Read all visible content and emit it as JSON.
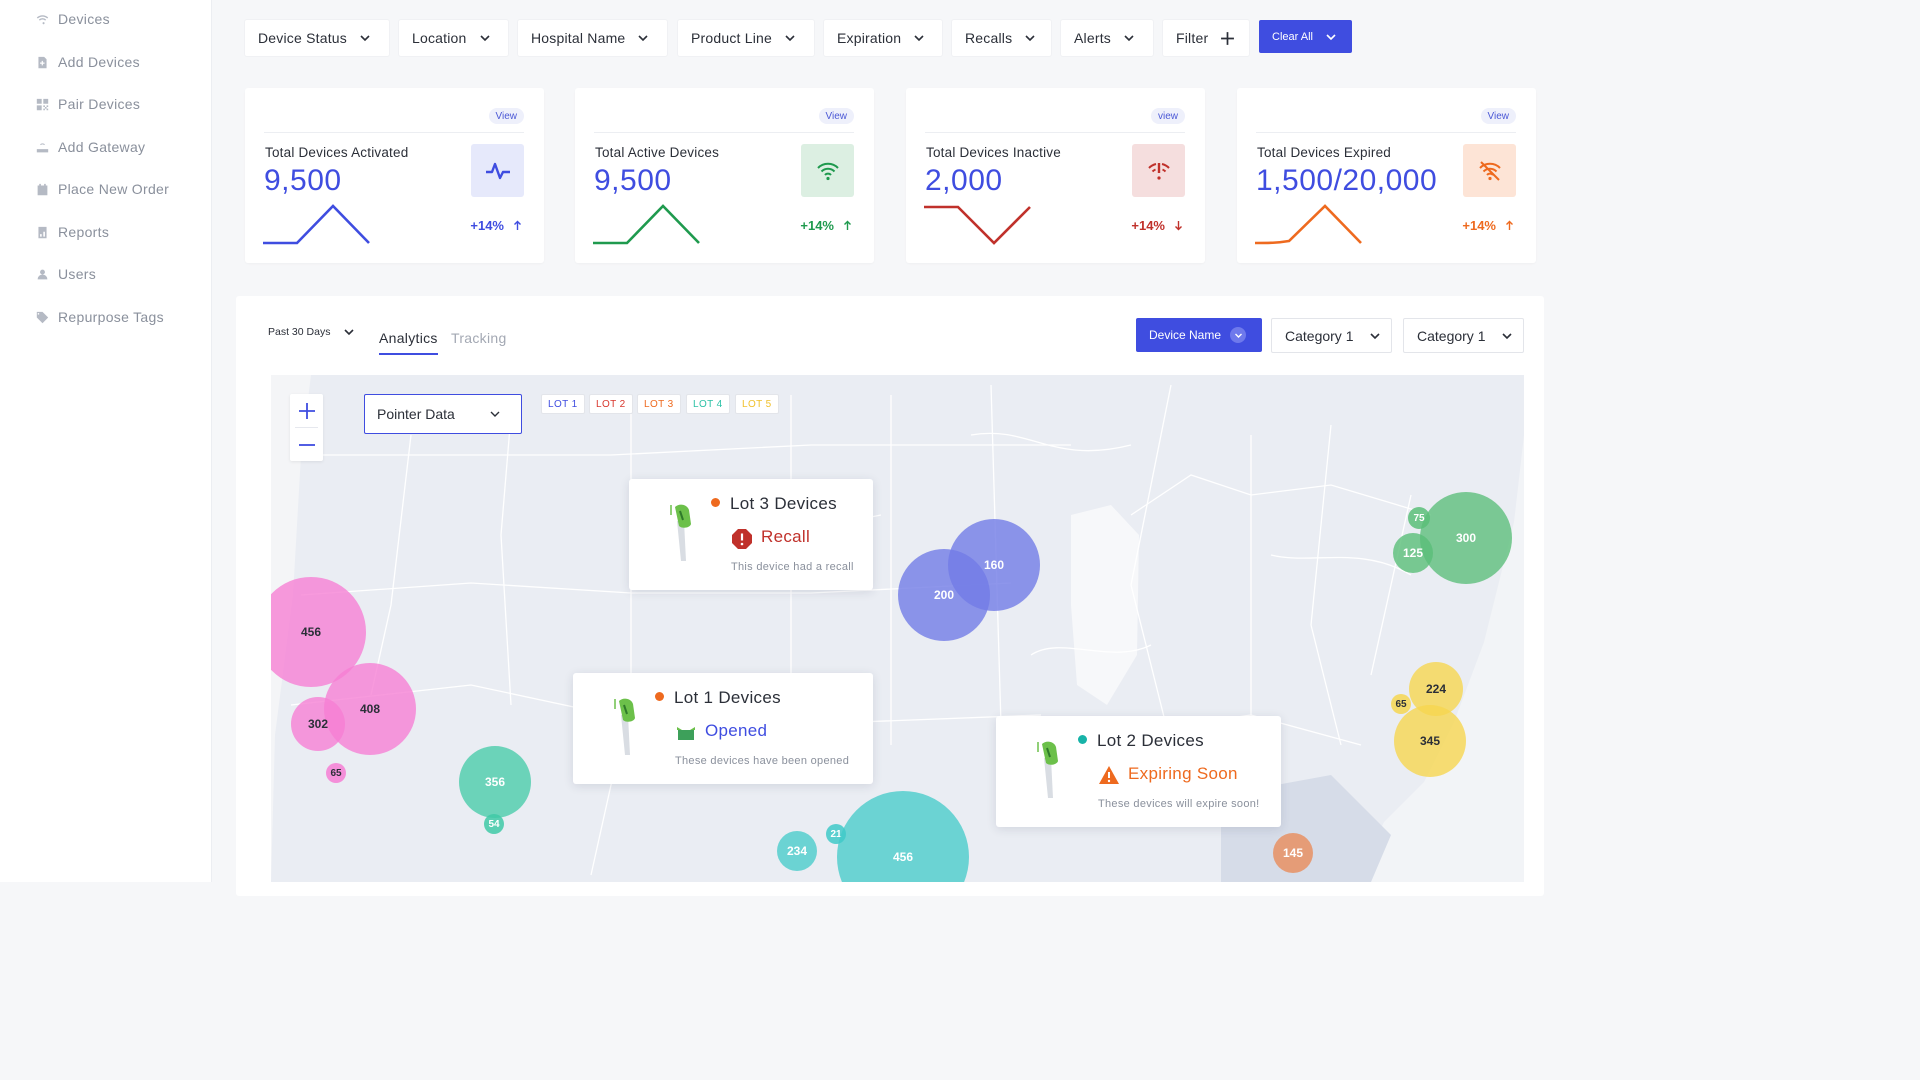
{
  "sidebar": {
    "items": [
      {
        "label": "Devices",
        "icon": "wifi-icon"
      },
      {
        "label": "Add Devices",
        "icon": "file-plus-icon"
      },
      {
        "label": "Pair Devices",
        "icon": "qr-icon"
      },
      {
        "label": "Add Gateway",
        "icon": "router-icon"
      },
      {
        "label": "Place New Order",
        "icon": "calendar-icon"
      },
      {
        "label": "Reports",
        "icon": "report-icon"
      },
      {
        "label": "Users",
        "icon": "users-icon"
      },
      {
        "label": "Repurpose Tags",
        "icon": "tag-icon"
      }
    ]
  },
  "filters": {
    "items": [
      "Device Status",
      "Location",
      "Hospital Name",
      "Product Line",
      "Expiration",
      "Recalls",
      "Alerts"
    ],
    "filter_label": "Filter",
    "clear_label": "Clear All"
  },
  "cards": [
    {
      "view": "View",
      "label": "Total Devices Activated",
      "value": "9,500",
      "pct": "+14%",
      "color": "#3f4de0",
      "bg": "#e6e9fb",
      "direction": "up",
      "icon": "activity-icon"
    },
    {
      "view": "View",
      "label": "Total Active Devices",
      "value": "9,500",
      "pct": "+14%",
      "color": "#1f9a4e",
      "bg": "#dcefe2",
      "direction": "up",
      "icon": "wifi-icon"
    },
    {
      "view": "view",
      "label": "Total Devices Inactive",
      "value": "2,000",
      "pct": "+14%",
      "color": "#c0312b",
      "bg": "#f5dede",
      "direction": "down",
      "icon": "wifi-alert-icon"
    },
    {
      "view": "View",
      "label": "Total Devices Expired",
      "value": "1,500/20,000",
      "pct": "+14%",
      "color": "#ee6a1f",
      "bg": "#fde4d6",
      "direction": "up",
      "icon": "wifi-off-icon"
    }
  ],
  "analytics": {
    "range": "Past 30 Days",
    "tabs": [
      "Analytics",
      "Tracking"
    ],
    "active_tab": "Analytics",
    "device_btn": "Device Name",
    "category1": "Category 1",
    "category2": "Category 1"
  },
  "map": {
    "pointer_select": "Pointer Data",
    "lots": [
      {
        "label": "LOT 1",
        "color": "#3f4de0"
      },
      {
        "label": "LOT 2",
        "color": "#d8372e"
      },
      {
        "label": "LOT 3",
        "color": "#ee6a1f"
      },
      {
        "label": "LOT 4",
        "color": "#2cc1a6"
      },
      {
        "label": "LOT 5",
        "color": "#f0c12e"
      }
    ],
    "bubbles": [
      {
        "v": "456",
        "color": "pink"
      },
      {
        "v": "408",
        "color": "pink"
      },
      {
        "v": "302",
        "color": "pink"
      },
      {
        "v": "65",
        "color": "pink"
      },
      {
        "v": "356",
        "color": "teal"
      },
      {
        "v": "54",
        "color": "teal"
      },
      {
        "v": "200",
        "color": "blue"
      },
      {
        "v": "160",
        "color": "blue"
      },
      {
        "v": "300",
        "color": "green"
      },
      {
        "v": "125",
        "color": "green"
      },
      {
        "v": "75",
        "color": "green"
      },
      {
        "v": "224",
        "color": "yellow"
      },
      {
        "v": "345",
        "color": "yellow"
      },
      {
        "v": "65",
        "color": "yellow"
      },
      {
        "v": "234",
        "color": "teal"
      },
      {
        "v": "21",
        "color": "teal"
      },
      {
        "v": "456",
        "color": "teal"
      },
      {
        "v": "145",
        "color": "orange"
      }
    ],
    "popups": [
      {
        "title": "Lot 3 Devices",
        "status": "Recall",
        "desc": "This device had a recall",
        "dot": "#ee6a1f",
        "status_color": "#c0312b"
      },
      {
        "title": "Lot 1 Devices",
        "status": "Opened",
        "desc": "These devices have been opened",
        "dot": "#ee6a1f",
        "status_color": "#3f4de0"
      },
      {
        "title": "Lot 2 Devices",
        "status": "Expiring Soon",
        "desc": "These devices will expire soon!",
        "dot": "#17b3a8",
        "status_color": "#ee6a1f"
      }
    ]
  }
}
